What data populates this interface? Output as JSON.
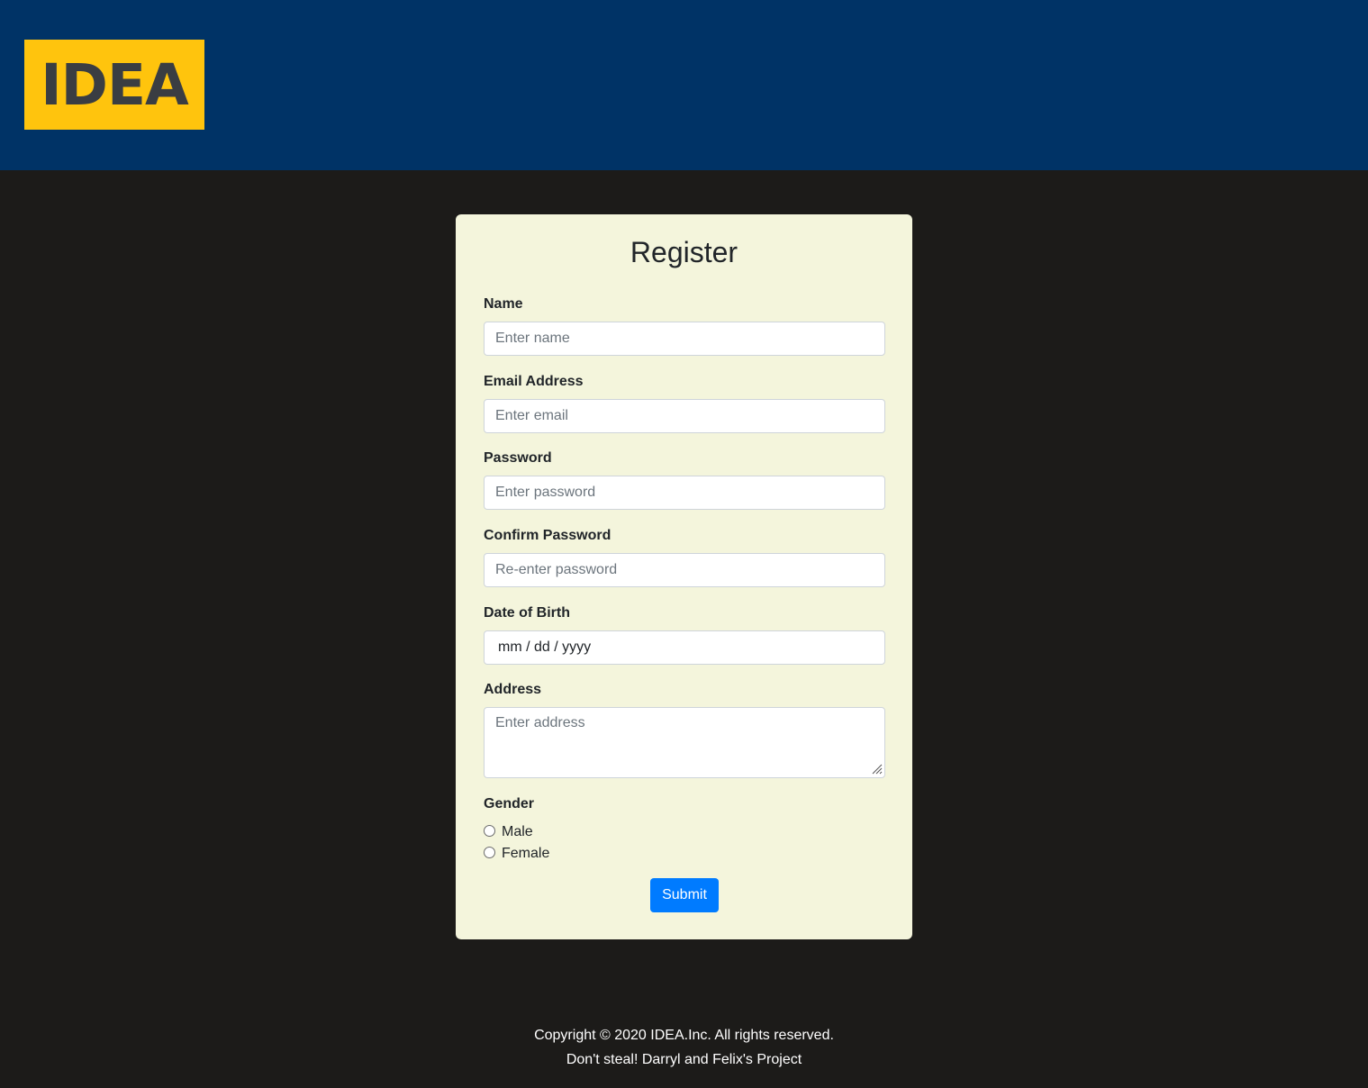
{
  "header": {
    "logo_text": "IDEA"
  },
  "form": {
    "title": "Register",
    "name_label": "Name",
    "name_placeholder": "Enter name",
    "email_label": "Email Address",
    "email_placeholder": "Enter email",
    "password_label": "Password",
    "password_placeholder": "Enter password",
    "confirm_label": "Confirm Password",
    "confirm_placeholder": "Re-enter password",
    "dob_label": "Date of Birth",
    "dob_value": "mm / dd / yyyy",
    "address_label": "Address",
    "address_placeholder": "Enter address",
    "gender_label": "Gender",
    "gender_options": [
      "Male",
      "Female"
    ],
    "submit_label": "Submit"
  },
  "footer": {
    "copyright": "Copyright © 2020 IDEA.Inc. All rights reserved.",
    "note": "Don't steal! Darryl and Felix's Project"
  },
  "colors": {
    "header_bg": "#003366",
    "logo_bg": "#ffc40d",
    "card_bg": "#f4f5dc",
    "page_bg": "#1c1b19",
    "primary": "#007bff"
  }
}
